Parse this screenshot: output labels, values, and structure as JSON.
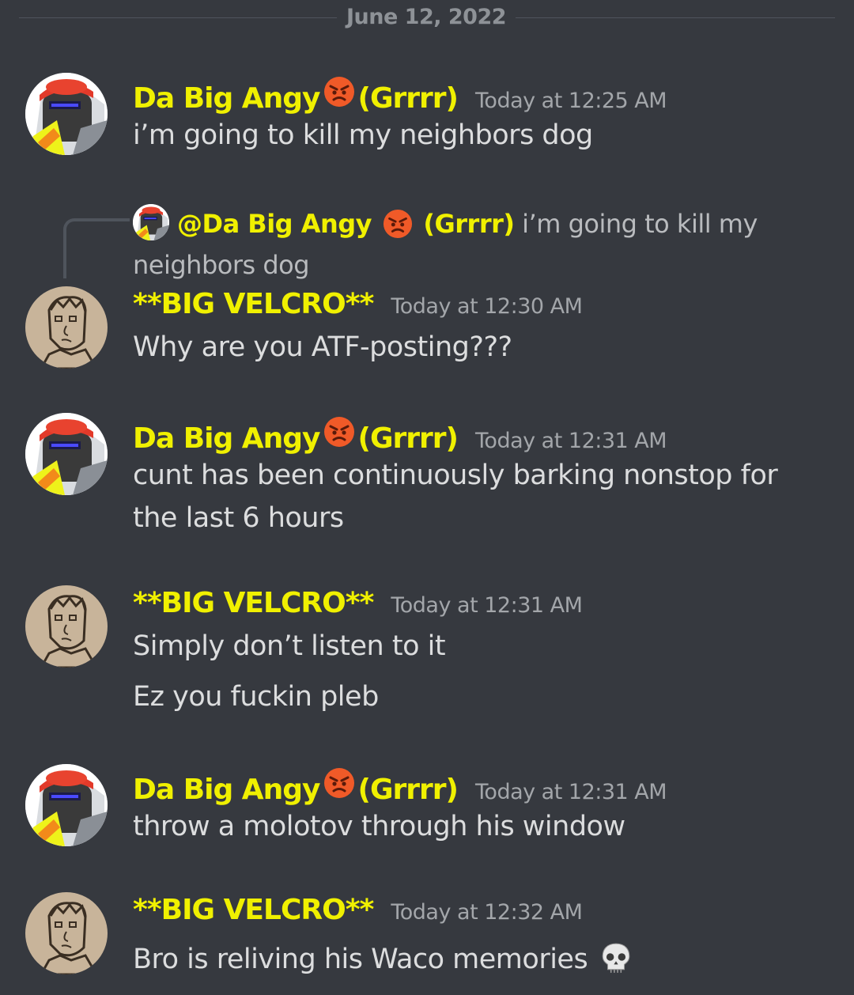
{
  "date_divider": "June 12, 2022",
  "users": {
    "angy": {
      "name": "Da Big Angy",
      "suffix": "(Grrrr)",
      "emoji": "angry-face-emoji"
    },
    "velcro": {
      "name": "**BIG VELCRO**"
    }
  },
  "messages": [
    {
      "author": "Da Big Angy",
      "suffix": "(Grrrr)",
      "timestamp": "Today at 12:25 AM",
      "lines": [
        "i’m going to kill my neighbors dog"
      ]
    },
    {
      "author": "**BIG VELCRO**",
      "timestamp": "Today at 12:30 AM",
      "reply": {
        "mention": "@Da Big Angy",
        "suffix": "(Grrrr)",
        "text_1": "i’m going to kill my",
        "text_2": "neighbors dog"
      },
      "lines": [
        "Why are you ATF-posting???"
      ]
    },
    {
      "author": "Da Big Angy",
      "suffix": "(Grrrr)",
      "timestamp": "Today at 12:31 AM",
      "lines": [
        "cunt has been continuously barking nonstop for",
        "the last 6 hours"
      ]
    },
    {
      "author": "**BIG VELCRO**",
      "timestamp": "Today at 12:31 AM",
      "lines": [
        "Simply don’t listen to it",
        "Ez you fuckin pleb"
      ]
    },
    {
      "author": "Da Big Angy",
      "suffix": "(Grrrr)",
      "timestamp": "Today at 12:31 AM",
      "lines": [
        "throw a molotov through his window"
      ]
    },
    {
      "author": "**BIG VELCRO**",
      "timestamp": "Today at 12:32 AM",
      "lines": [
        "Bro is reliving his Waco memories"
      ],
      "trailing_emoji": "skull-emoji"
    }
  ],
  "colors": {
    "background": "#36393f",
    "username": "#f0f000",
    "timestamp": "#a3a6aa",
    "message_text": "#dcddde",
    "divider": "#4f545c"
  }
}
